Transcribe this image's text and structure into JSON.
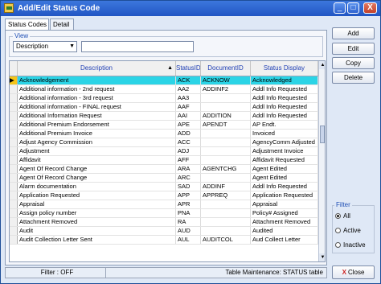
{
  "window": {
    "title": "Add/Edit Status Code"
  },
  "titlebar_buttons": {
    "minimize": "_",
    "maximize": "□",
    "close": "X"
  },
  "tabs": [
    {
      "label": "Status Codes",
      "active": true
    },
    {
      "label": "Detail",
      "active": false
    }
  ],
  "view": {
    "legend": "View",
    "select_value": "Description",
    "select_arrow": "▼",
    "search_value": ""
  },
  "grid": {
    "columns": [
      "Description",
      "StatusID",
      "DocumentID",
      "Status Display"
    ],
    "sort_indicator": "▲",
    "selected_marker": "▶",
    "rows": [
      [
        "Acknowledgement",
        "ACK",
        "ACKNOW",
        "Acknowledged"
      ],
      [
        "Additional information - 2nd request",
        "AA2",
        "ADDINF2",
        "Addl Info Requested"
      ],
      [
        "Additional information - 3rd request",
        "AA3",
        "",
        "Addl Info Requested"
      ],
      [
        "Additional information - FINAL request",
        "AAF",
        "",
        "Addl Info Requested"
      ],
      [
        "Additional Information Request",
        "AAI",
        "ADDITION",
        "Addl Info Requested"
      ],
      [
        "Additional Premium Endorsement",
        "APE",
        "APENDT",
        "AP Endt."
      ],
      [
        "Additional Premium Invoice",
        "ADD",
        "",
        "Invoiced"
      ],
      [
        "Adjust Agency Commission",
        "ACC",
        "",
        "AgencyComm Adjusted"
      ],
      [
        "Adjustment",
        "ADJ",
        "",
        "Adjustment Invoice"
      ],
      [
        "Affidavit",
        "AFF",
        "",
        "Affidavit Requested"
      ],
      [
        "Agent Of Record Change",
        "ARA",
        "AGENTCHG",
        "Agent Edited"
      ],
      [
        "Agent Of Record Change",
        "ARC",
        "",
        "Agent Edited"
      ],
      [
        "Alarm documentation",
        "SAD",
        "ADDINF",
        "Addl Info Requested"
      ],
      [
        "Application Requested",
        "APP",
        "APPREQ",
        "Application Requested"
      ],
      [
        "Appraisal",
        "APR",
        "",
        "Appraisal"
      ],
      [
        "Assign policy number",
        "PNA",
        "",
        "Policy# Assigned"
      ],
      [
        "Attachment Removed",
        "RA",
        "",
        "Attachment Removed"
      ],
      [
        "Audit",
        "AUD",
        "",
        "Audited"
      ],
      [
        "Audit Collection Letter Sent",
        "AUL",
        "AUDITCOL",
        "Aud Collect Letter"
      ]
    ],
    "scroll_up": "▲",
    "scroll_down": "▼"
  },
  "buttons": {
    "add": "Add",
    "edit": "Edit",
    "copy": "Copy",
    "delete": "Delete",
    "close": "Close",
    "close_icon": "X"
  },
  "filter": {
    "legend": "Filter",
    "options": [
      {
        "label": "All",
        "selected": true
      },
      {
        "label": "Active",
        "selected": false
      },
      {
        "label": "Inactive",
        "selected": false
      }
    ]
  },
  "status": {
    "filter": "Filter : OFF",
    "table": "Table Maintenance:  STATUS table"
  },
  "colors": {
    "titlebar": "#2256c4",
    "selected_row": "#2bd4e6",
    "selected_marker": "#f5c518",
    "header_text": "#1f3fb5"
  }
}
